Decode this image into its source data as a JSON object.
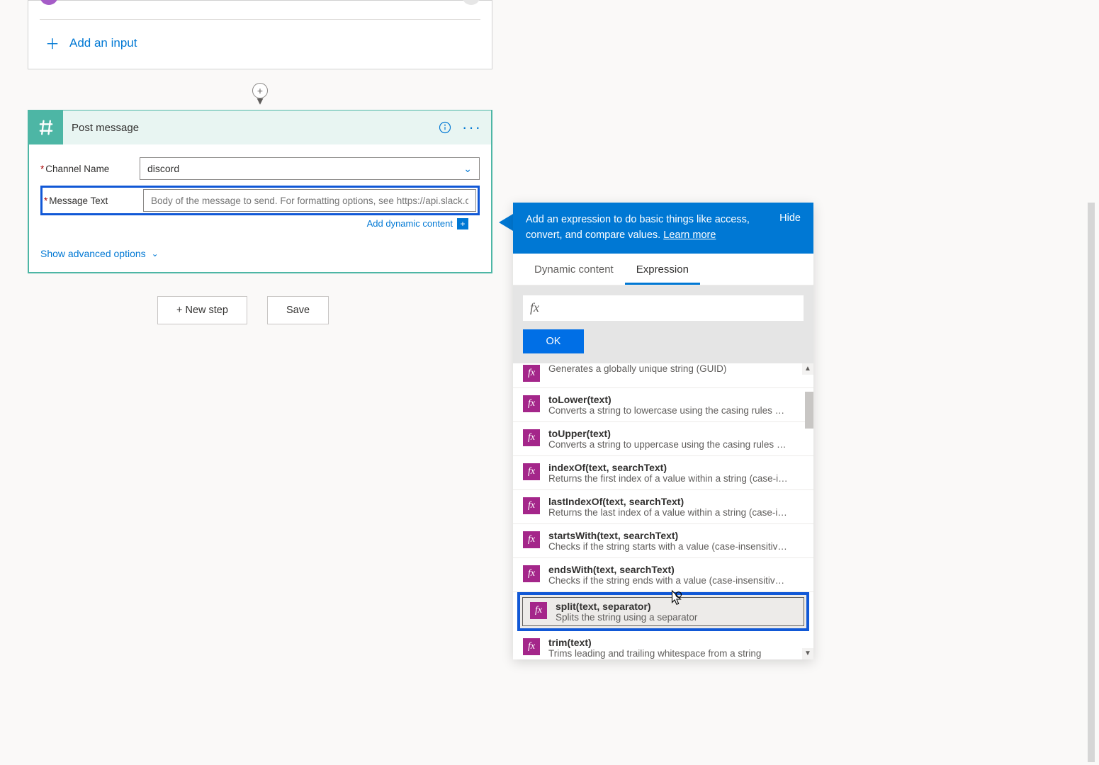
{
  "trigger": {
    "add_input_label": "Add an input"
  },
  "action": {
    "title": "Post message",
    "fields": {
      "channel_label": "Channel Name",
      "channel_value": "discord",
      "message_label": "Message Text",
      "message_placeholder": "Body of the message to send. For formatting options, see https://api.slack.com,"
    },
    "add_dynamic_label": "Add dynamic content",
    "show_advanced_label": "Show advanced options"
  },
  "footer": {
    "new_step_label": "+ New step",
    "save_label": "Save"
  },
  "dc": {
    "header_text_1": "Add an expression to do basic things like access, convert, and compare values. ",
    "learn_more": "Learn more",
    "hide_label": "Hide",
    "tab_dynamic": "Dynamic content",
    "tab_expression": "Expression",
    "ok_label": "OK",
    "fx_symbol": "fx",
    "items": [
      {
        "name": "",
        "desc": "Generates a globally unique string (GUID)",
        "partial_top": true
      },
      {
        "name": "toLower(text)",
        "desc": "Converts a string to lowercase using the casing rules of t..."
      },
      {
        "name": "toUpper(text)",
        "desc": "Converts a string to uppercase using the casing rules of t..."
      },
      {
        "name": "indexOf(text, searchText)",
        "desc": "Returns the first index of a value within a string (case-inse..."
      },
      {
        "name": "lastIndexOf(text, searchText)",
        "desc": "Returns the last index of a value within a string (case-inse..."
      },
      {
        "name": "startsWith(text, searchText)",
        "desc": "Checks if the string starts with a value (case-insensitive, in..."
      },
      {
        "name": "endsWith(text, searchText)",
        "desc": "Checks if the string ends with a value (case-insensitive, in..."
      },
      {
        "name": "split(text, separator)",
        "desc": "Splits the string using a separator",
        "selected": true
      },
      {
        "name": "trim(text)",
        "desc": "Trims leading and trailing whitespace from a string"
      }
    ]
  }
}
